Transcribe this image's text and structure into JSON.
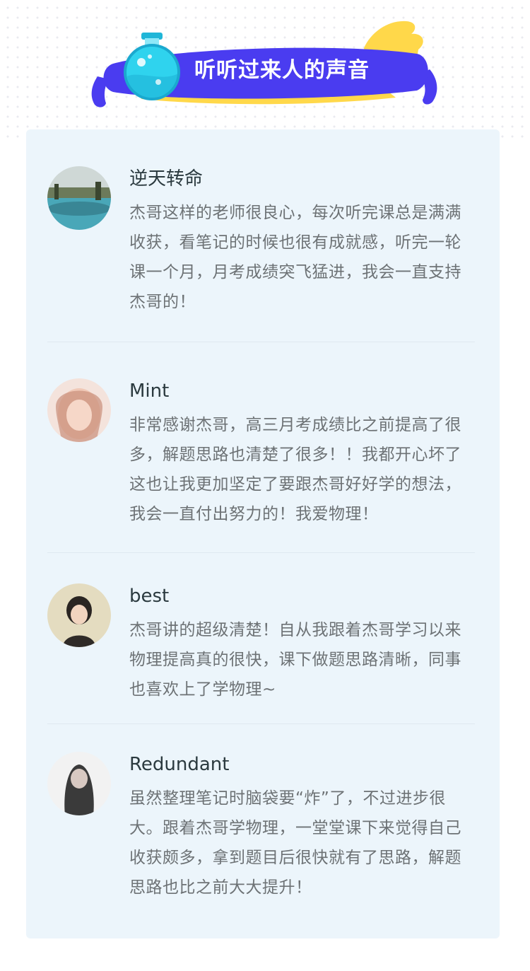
{
  "header": {
    "title": "听听过来人的声音"
  },
  "testimonials": [
    {
      "name": "逆天转命",
      "comment": "杰哥这样的老师很良心，每次听完课总是满满收获，看笔记的时候也很有成就感，听完一轮课一个月，月考成绩突飞猛进，我会一直支持杰哥的！"
    },
    {
      "name": "Mint",
      "comment": "非常感谢杰哥，高三月考成绩比之前提高了很多，解题思路也清楚了很多！！我都开心坏了这也让我更加坚定了要跟杰哥好好学的想法，我会一直付出努力的！我爱物理！"
    },
    {
      "name": "best",
      "comment": "杰哥讲的超级清楚！自从我跟着杰哥学习以来物理提高真的很快，课下做题思路清晰，同事也喜欢上了学物理~"
    },
    {
      "name": "Redundant",
      "comment": "虽然整理笔记时脑袋要“炸”了，不过进步很大。跟着杰哥学物理，一堂堂课下来觉得自己收获颇多，拿到题目后很快就有了思路，解题思路也比之前大大提升！"
    }
  ],
  "colors": {
    "banner_purple": "#4a3cf0",
    "banner_yellow": "#ffd84a",
    "flask_cyan": "#2fd3ee",
    "card_bg": "#ecf5fb",
    "name_text": "#2b3a3f",
    "comment_text": "#6d7275"
  },
  "icons": {
    "banner": "flask-icon"
  }
}
